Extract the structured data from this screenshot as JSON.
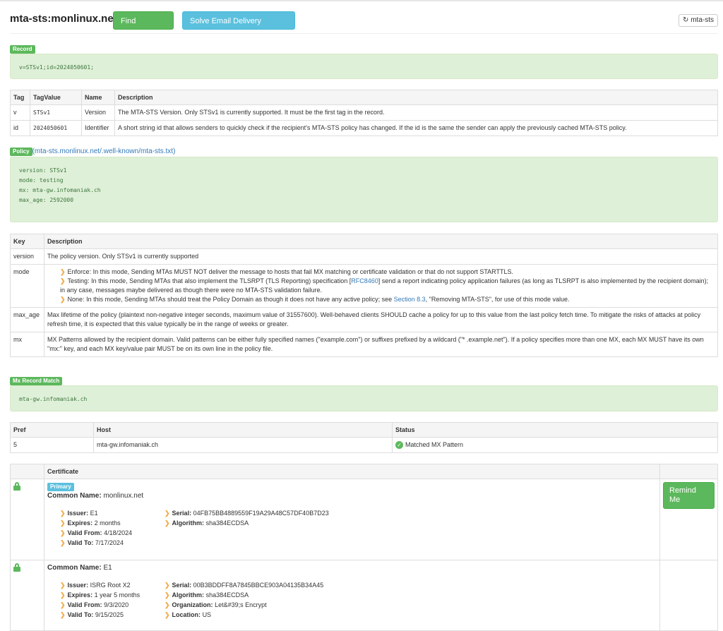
{
  "header": {
    "title": "mta-sts:monlinux.net",
    "find_problems": "Find Problems",
    "solve_email": "Solve Email Delivery Problems",
    "refresh_label": "mta-sts"
  },
  "record": {
    "label": "Record",
    "value": "v=STSv1;id=2024050601;",
    "columns": [
      "Tag",
      "TagValue",
      "Name",
      "Description"
    ],
    "rows": [
      {
        "tag": "v",
        "value": "STSv1",
        "name": "Version",
        "desc": "The MTA-STS Version. Only STSv1 is currently supported. It must be the first tag in the record."
      },
      {
        "tag": "id",
        "value": "2024050601",
        "name": "Identifier",
        "desc": "A short string id that allows senders to quickly check if the recipient's MTA-STS policy has changed. If the id is the same the sender can apply the previously cached MTA-STS policy."
      }
    ]
  },
  "policy": {
    "label": "Policy",
    "link_open": "(",
    "link": "mta-sts.monlinux.net/.well-known/mta-sts.txt",
    "link_close": ")",
    "lines": [
      "version: STSv1",
      "mode: testing",
      "mx: mta-gw.infomaniak.ch",
      "max_age: 2592000"
    ],
    "columns": [
      "Key",
      "Description"
    ],
    "version_key": "version",
    "version_desc": "The policy version. Only STSv1 is currently supported",
    "mode_key": "mode",
    "mode_enforce": "Enforce: In this mode, Sending MTAs MUST NOT deliver the message to hosts that fail MX matching or certificate validation or that do not support STARTTLS.",
    "mode_testing_a": "Testing: In this mode, Sending MTAs that also implement the TLSRPT (TLS Reporting) specification [",
    "mode_testing_link": "RFC8460",
    "mode_testing_b": "] send a report indicating policy application failures (as long as TLSRPT is also implemented by the recipient domain); in any case, messages maybe delivered as though there were no MTA-STS validation failure.",
    "mode_none_a": "None: In this mode, Sending MTAs should treat the Policy Domain as though it does not have any active policy; see ",
    "mode_none_link": "Section 8.3",
    "mode_none_b": ", \"Removing MTA-STS\", for use of this mode value.",
    "maxage_key": "max_age",
    "maxage_desc": "Max lifetime of the policy (plaintext non-negative integer seconds, maximum value of 31557600). Well-behaved clients SHOULD cache a policy for up to this value from the last policy fetch time. To mitigate the risks of attacks at policy refresh time, it is expected that this value typically be in the range of weeks or greater.",
    "mx_key": "mx",
    "mx_desc": "MX Patterns allowed by the recipient domain. Valid patterns can be either fully specified names (\"example.com\") or suffixes prefixed by a wildcard (\"* .example.net\"). If a policy specifies more than one MX, each MX MUST have its own \"mx:\" key, and each MX key/value pair MUST be on its own line in the policy file."
  },
  "mxmatch": {
    "label": "Mx Record Match",
    "value": "mta-gw.infomaniak.ch",
    "columns": [
      "Pref",
      "Host",
      "Status"
    ],
    "row": {
      "pref": "5",
      "host": "mta-gw.infomaniak.ch",
      "status": "Matched MX Pattern"
    }
  },
  "certs": {
    "header": "Certificate",
    "remind": "Remind Me",
    "primary_badge": "Primary",
    "cn_label": "Common Name:",
    "issuer_label": "Issuer:",
    "expires_label": "Expires:",
    "validfrom_label": "Valid From:",
    "validto_label": "Valid To:",
    "serial_label": "Serial:",
    "algorithm_label": "Algorithm:",
    "org_label": "Organization:",
    "location_label": "Location:",
    "c1": {
      "cn": "monlinux.net",
      "issuer": "E1",
      "expires": "2 months",
      "valid_from": "4/18/2024",
      "valid_to": "7/17/2024",
      "serial": "04FB75BB4889559F19A29A48C57DF40B7D23",
      "algorithm": "sha384ECDSA"
    },
    "c2": {
      "cn": "E1",
      "issuer": "ISRG Root X2",
      "expires": "1 year 5 months",
      "valid_from": "9/3/2020",
      "valid_to": "9/15/2025",
      "serial": "00B3BDDFF8A7845BBCE903A04135B34A45",
      "algorithm": "sha384ECDSA",
      "organization": "Let&#39;s Encrypt",
      "location": "US"
    }
  }
}
